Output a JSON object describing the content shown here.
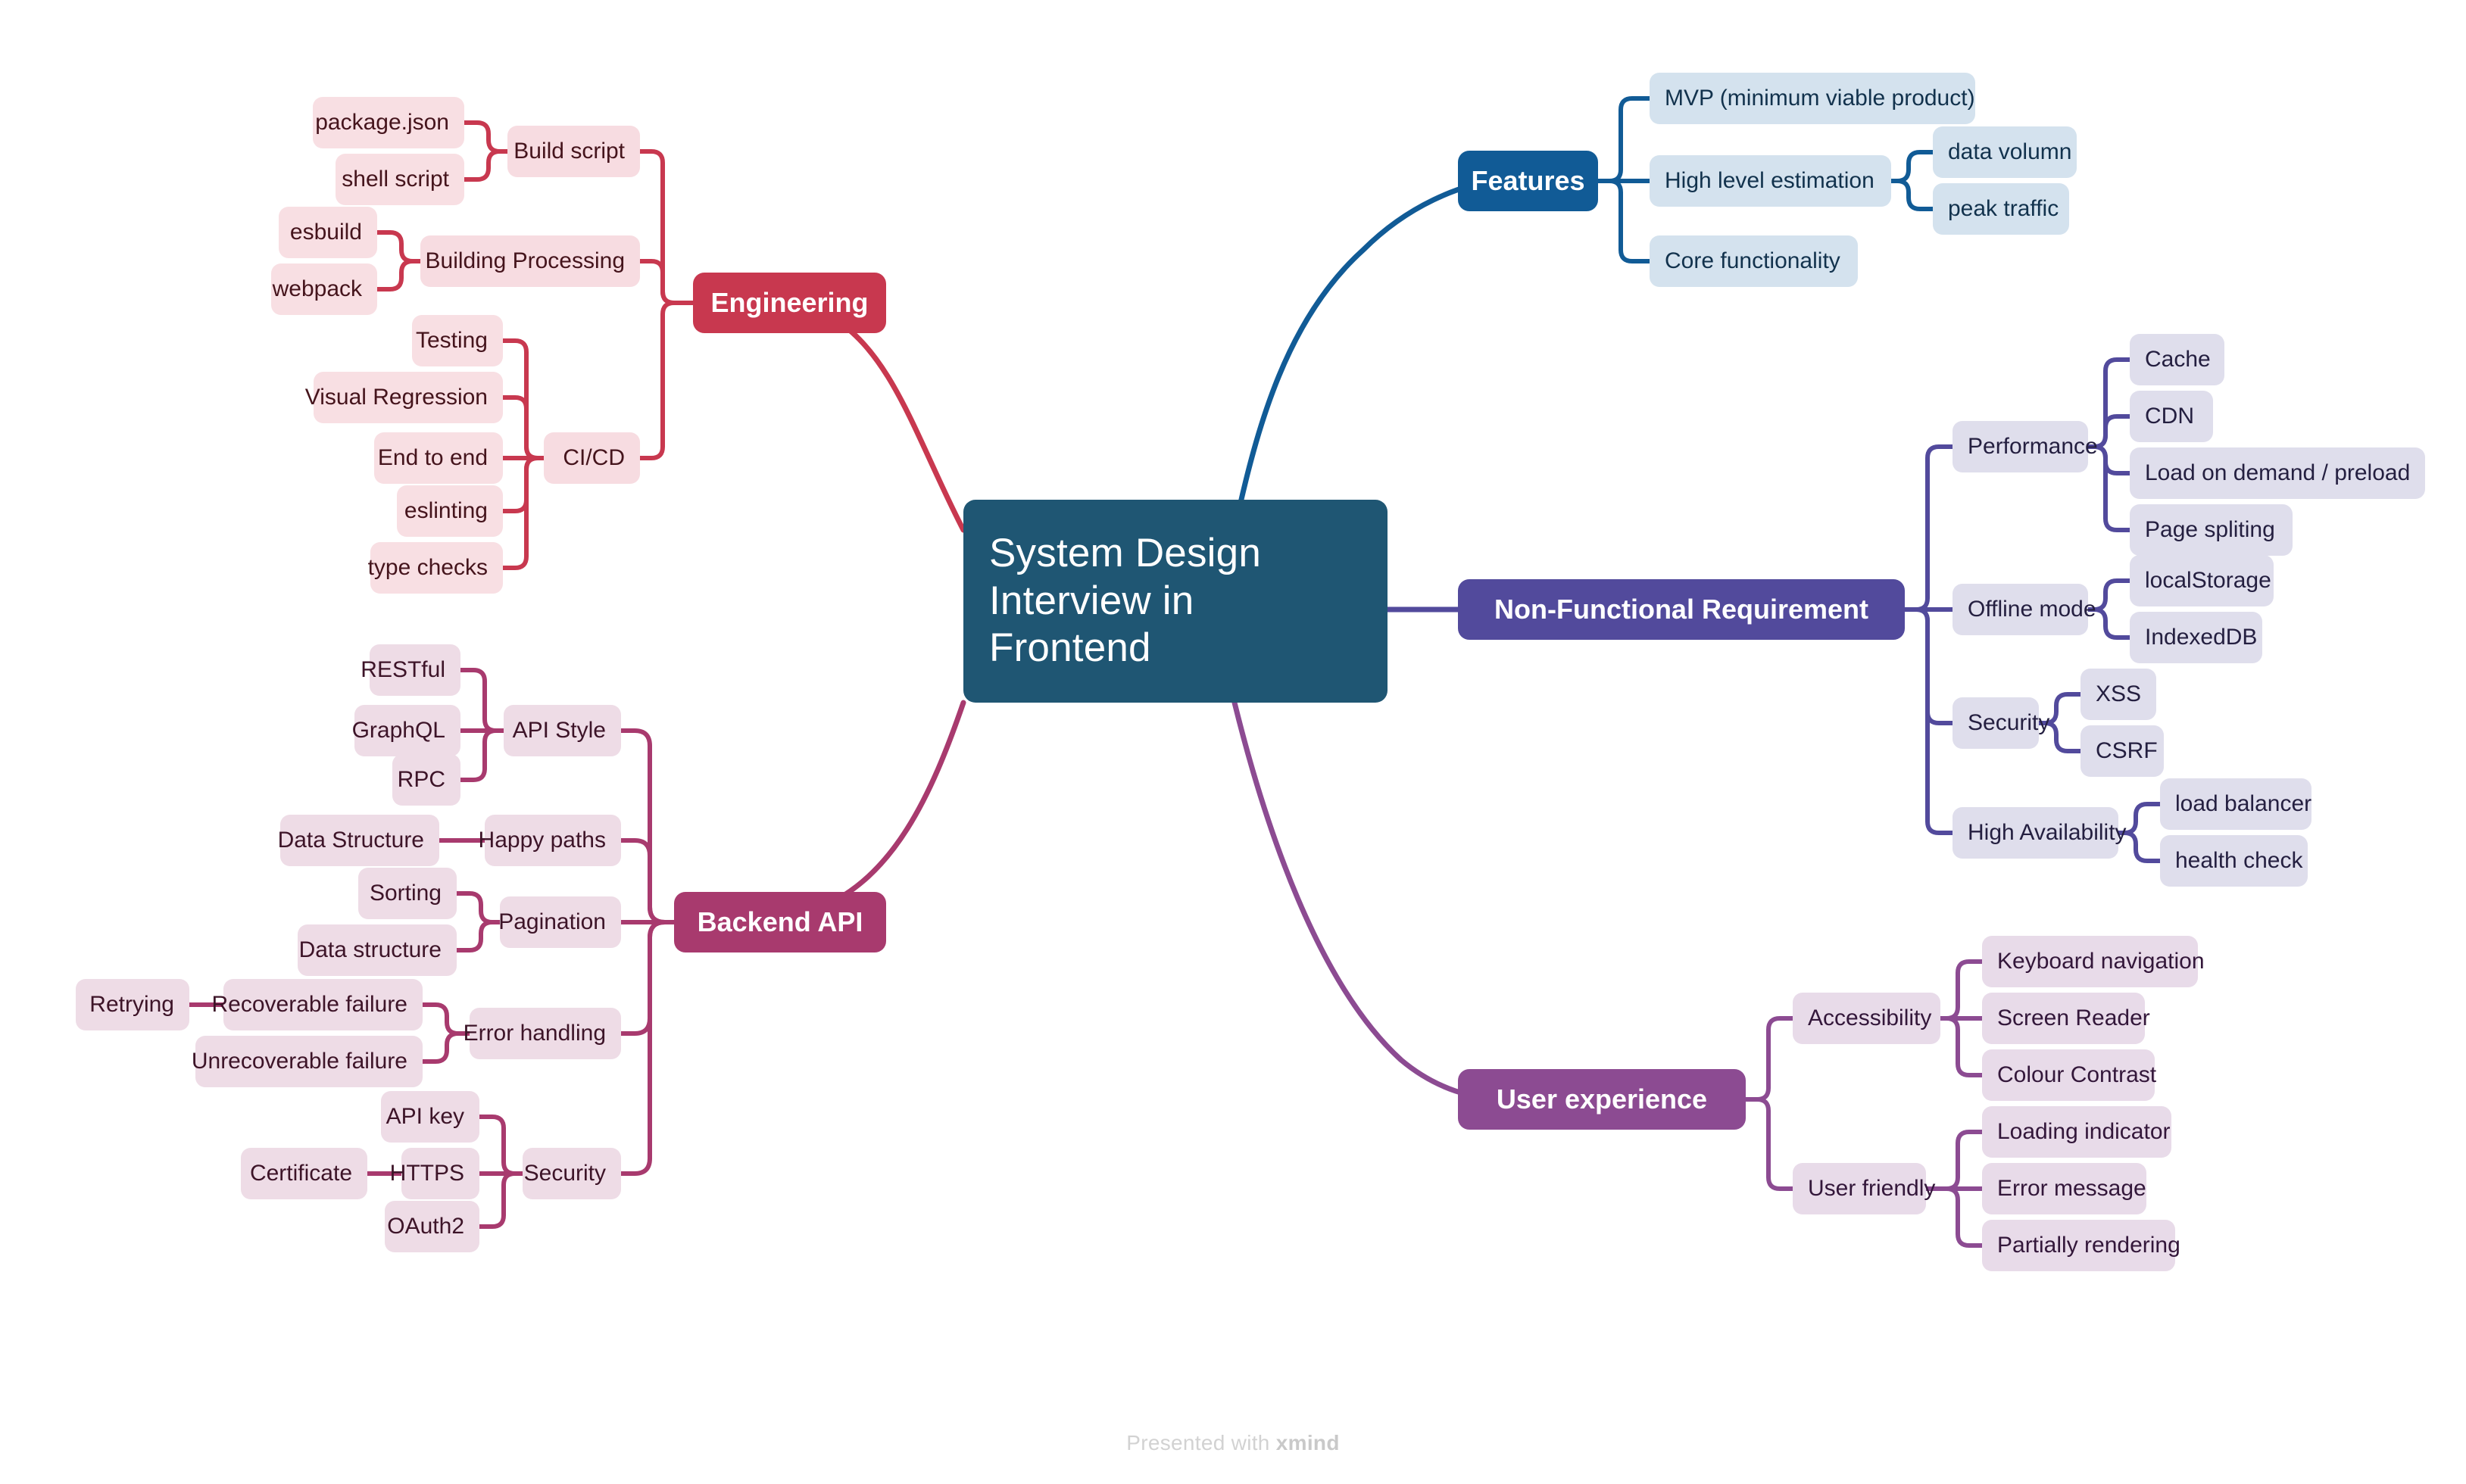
{
  "root": {
    "line1": "System Design",
    "line2": "Interview in",
    "line3": "Frontend",
    "color": "#1f5673"
  },
  "footer": {
    "prefix": "Presented with ",
    "brand": "xmind"
  },
  "branches": {
    "engineering": {
      "label": "Engineering",
      "color": "#c8384f",
      "leaf_bg": "#f8dfe3",
      "sub_bg": "#f7dce1",
      "text": "#45141c",
      "children": [
        {
          "label": "Build script",
          "children": [
            "package.json",
            "shell script"
          ]
        },
        {
          "label": "Building Processing",
          "children": [
            "esbuild",
            "webpack"
          ]
        },
        {
          "label": "CI/CD",
          "children": [
            "Testing",
            "Visual Regression",
            "End to end",
            "eslinting",
            "type checks"
          ]
        }
      ]
    },
    "features": {
      "label": "Features",
      "color": "#115b96",
      "leaf_bg": "#d4e2ee",
      "sub_bg": "#d4e2ee",
      "text": "#12324d",
      "children": [
        {
          "label": "MVP (minimum viable product)",
          "children": []
        },
        {
          "label": "High level estimation",
          "children": [
            "data volumn",
            "peak traffic"
          ]
        },
        {
          "label": "Core functionality",
          "children": []
        }
      ]
    },
    "nonfunctional": {
      "label": "Non-Functional Requirement",
      "color": "#524a9c",
      "leaf_bg": "#dfdeec",
      "sub_bg": "#dfdeec",
      "text": "#241f४0",
      "children": [
        {
          "label": "Performance",
          "children": [
            "Cache",
            "CDN",
            "Load on demand / preload",
            "Page spliting"
          ]
        },
        {
          "label": "Offline mode",
          "children": [
            "localStorage",
            "IndexedDB"
          ]
        },
        {
          "label": "Security",
          "children": [
            "XSS",
            "CSRF"
          ]
        },
        {
          "label": "High Availability",
          "children": [
            "load balancer",
            "health check"
          ]
        }
      ]
    },
    "backend": {
      "label": "Backend API",
      "color": "#a83a6e",
      "leaf_bg": "#eedce6",
      "sub_bg": "#eedce6",
      "text": "#3d1428",
      "children": [
        {
          "label": "API Style",
          "children": [
            "RESTful",
            "GraphQL",
            "RPC"
          ]
        },
        {
          "label": "Happy paths",
          "children": [
            "Data Structure"
          ]
        },
        {
          "label": "Pagination",
          "children": [
            "Sorting",
            "Data structure"
          ]
        },
        {
          "label": "Error handling",
          "children": [
            "Recoverable failure",
            "Unrecoverable failure"
          ]
        },
        {
          "label": "Security",
          "children": [
            "API key",
            "HTTPS",
            "OAuth2"
          ]
        }
      ],
      "grandchildren": [
        {
          "parent": "Recoverable failure",
          "label": "Retrying"
        },
        {
          "parent": "HTTPS",
          "label": "Certificate"
        }
      ]
    },
    "userexperience": {
      "label": "User experience",
      "color": "#8c4b92",
      "leaf_bg": "#e8dbe9",
      "sub_bg": "#e8dbe9",
      "text": "#33173a",
      "children": [
        {
          "label": "Accessibility",
          "children": [
            "Keyboard navigation",
            "Screen Reader",
            "Colour Contrast"
          ]
        },
        {
          "label": "User friendly",
          "children": [
            "Loading indicator",
            "Error message",
            "Partially rendering"
          ]
        }
      ]
    }
  },
  "nodes": {
    "eng_build_script": "Build script",
    "eng_package_json": "package.json",
    "eng_shell_script": "shell script",
    "eng_building_processing": "Building Processing",
    "eng_esbuild": "esbuild",
    "eng_webpack": "webpack",
    "eng_cicd": "CI/CD",
    "eng_testing": "Testing",
    "eng_visual_regression": "Visual Regression",
    "eng_end_to_end": "End to end",
    "eng_eslinting": "eslinting",
    "eng_type_checks": "type checks",
    "feat_mvp": "MVP (minimum viable product)",
    "feat_hle": "High level estimation",
    "feat_data_volumn": "data volumn",
    "feat_peak_traffic": "peak traffic",
    "feat_core_functionality": "Core functionality",
    "nfr_performance": "Performance",
    "nfr_cache": "Cache",
    "nfr_cdn": "CDN",
    "nfr_load_on_demand": "Load on demand / preload",
    "nfr_page_spliting": "Page spliting",
    "nfr_offline_mode": "Offline mode",
    "nfr_localstorage": "localStorage",
    "nfr_indexeddb": "IndexedDB",
    "nfr_security": "Security",
    "nfr_xss": "XSS",
    "nfr_csrf": "CSRF",
    "nfr_high_availability": "High Availability",
    "nfr_load_balancer": "load balancer",
    "nfr_health_check": "health check",
    "be_api_style": "API Style",
    "be_restful": "RESTful",
    "be_graphql": "GraphQL",
    "be_rpc": "RPC",
    "be_happy_paths": "Happy paths",
    "be_data_structure_hp": "Data Structure",
    "be_pagination": "Pagination",
    "be_sorting": "Sorting",
    "be_data_structure_pg": "Data structure",
    "be_error_handling": "Error handling",
    "be_recoverable": "Recoverable failure",
    "be_unrecoverable": "Unrecoverable failure",
    "be_retrying": "Retrying",
    "be_security": "Security",
    "be_api_key": "API key",
    "be_https": "HTTPS",
    "be_certificate": "Certificate",
    "be_oauth2": "OAuth2",
    "ux_accessibility": "Accessibility",
    "ux_keyboard_navigation": "Keyboard navigation",
    "ux_screen_reader": "Screen Reader",
    "ux_colour_contrast": "Colour Contrast",
    "ux_user_friendly": "User friendly",
    "ux_loading_indicator": "Loading indicator",
    "ux_error_message": "Error message",
    "ux_partially_rendering": "Partially rendering"
  }
}
